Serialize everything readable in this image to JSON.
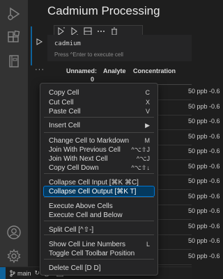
{
  "title": "Cadmium Processing",
  "cell": {
    "code": "cadmium",
    "hint": "Press ^Enter to execute cell"
  },
  "table": {
    "headers": {
      "unnamed": "Unnamed:",
      "unnamed_sub": "0",
      "analyte": "Analyte",
      "concentration": "Concentration"
    },
    "rows": [
      {
        "a": "50 ppb",
        "b": "-0.6"
      },
      {
        "a": "50 ppb",
        "b": "-0.6"
      },
      {
        "a": "50 ppb",
        "b": "-0.6"
      },
      {
        "a": "50 ppb",
        "b": "-0.6"
      },
      {
        "a": "50 ppb",
        "b": "-0.6"
      },
      {
        "a": "50 ppb",
        "b": "-0.6"
      },
      {
        "a": "50 ppb",
        "b": "-0.6"
      },
      {
        "a": "50 ppb",
        "b": "-0.6"
      },
      {
        "a": "50 ppb",
        "b": "-0.6"
      },
      {
        "a": "50 ppb",
        "b": "-0.6"
      },
      {
        "a": "50 ppb",
        "b": "-0.6"
      },
      {
        "a": "50 ppb",
        "b": "-0.6"
      }
    ]
  },
  "menu": {
    "items": [
      {
        "label": "Copy Cell",
        "shortcut": "C"
      },
      {
        "label": "Cut Cell",
        "shortcut": "X"
      },
      {
        "label": "Paste Cell",
        "shortcut": "V"
      },
      {
        "label": "Insert Cell",
        "shortcut": "▶"
      },
      {
        "label": "Change Cell to Markdown",
        "shortcut": "M"
      },
      {
        "label": "Join With Previous Cell",
        "shortcut": "^⌥⇧J"
      },
      {
        "label": "Join With Next Cell",
        "shortcut": "^⌥J"
      },
      {
        "label": "Copy Cell Down",
        "shortcut": "^⌥⇧↓"
      },
      {
        "label": "Collapse Cell Input [⌘K ⌘C]",
        "shortcut": ""
      },
      {
        "label": "Collapse Cell Output [⌘K T]",
        "shortcut": ""
      },
      {
        "label": "Execute Above Cells",
        "shortcut": ""
      },
      {
        "label": "Execute Cell and Below",
        "shortcut": ""
      },
      {
        "label": "Split Cell [^⇧-]",
        "shortcut": ""
      },
      {
        "label": "Show Cell Line Numbers",
        "shortcut": "L"
      },
      {
        "label": "Toggle Cell Toolbar Position",
        "shortcut": ""
      },
      {
        "label": "Delete Cell [D D]",
        "shortcut": ""
      }
    ]
  },
  "status": {
    "branch": "main",
    "sync": "↻",
    "errors": "0",
    "warnings": "0",
    "ports": "0"
  },
  "colors": {
    "accent": "#0e639c",
    "highlight": "#04395e",
    "menu_bg": "#252526"
  }
}
